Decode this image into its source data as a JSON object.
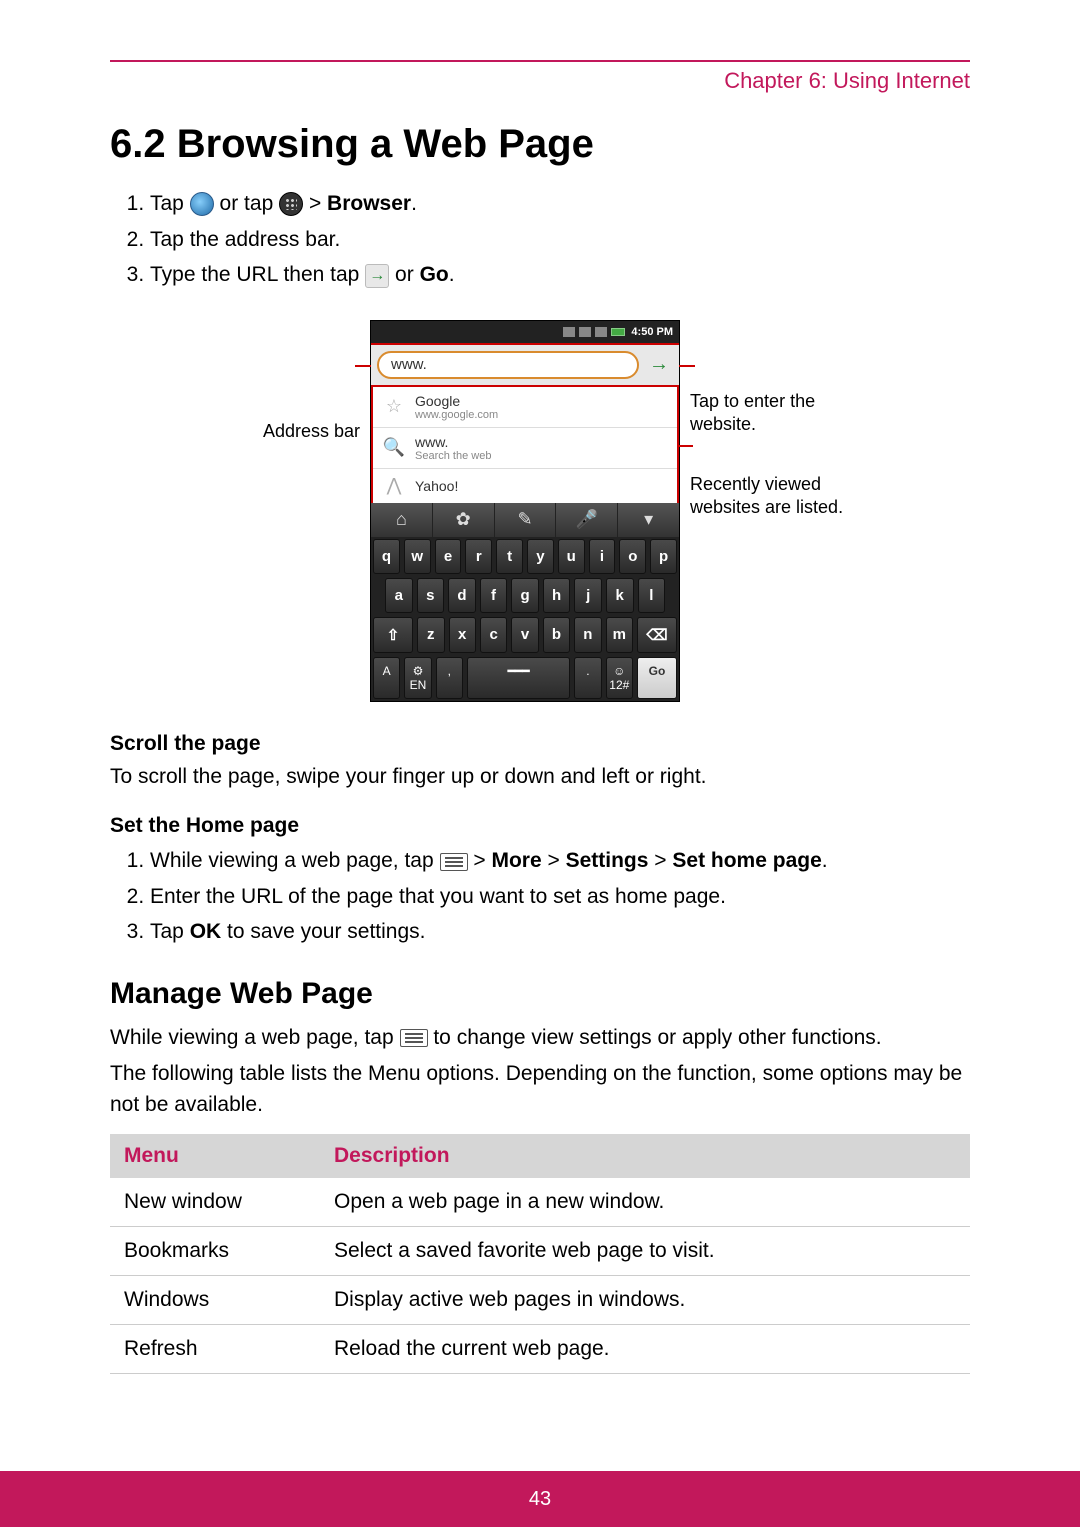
{
  "chapter": "Chapter 6: Using Internet",
  "heading": "6.2 Browsing a Web Page",
  "steps1": {
    "s1a": "Tap ",
    "s1b": " or tap ",
    "s1c": " > ",
    "s1d": "Browser",
    "s1e": ".",
    "s2": "Tap the address bar.",
    "s3a": "Type the URL then tap ",
    "s3b": " or ",
    "s3c": "Go",
    "s3d": "."
  },
  "figure": {
    "left_label": "Address bar",
    "right_label_1": "Tap to enter the website.",
    "right_label_2": "Recently viewed websites are listed.",
    "status_time": "4:50 PM",
    "addr_value": "www.",
    "suggestions": [
      {
        "icon": "star",
        "title": "Google",
        "sub": "www.google.com"
      },
      {
        "icon": "search",
        "title": "www.",
        "sub": "Search the web"
      },
      {
        "icon": "yahoo",
        "title": "Yahoo!",
        "sub": ""
      }
    ],
    "keys_row1": [
      "q",
      "w",
      "e",
      "r",
      "t",
      "y",
      "u",
      "i",
      "o",
      "p"
    ],
    "keys_row2": [
      "a",
      "s",
      "d",
      "f",
      "g",
      "h",
      "j",
      "k",
      "l"
    ],
    "keys_row3": [
      "⇧",
      "z",
      "x",
      "c",
      "v",
      "b",
      "n",
      "m",
      "⌫"
    ],
    "keys_row4_left1": "A",
    "keys_row4_left2_top": "⚙",
    "keys_row4_left2_bot": "EN",
    "keys_row4_comma": ",",
    "keys_row4_space": " ",
    "keys_row4_dot": ".",
    "keys_row4_sym_top": "☺",
    "keys_row4_sym_bot": "12#",
    "keys_row4_go": "Go"
  },
  "scroll_head": "Scroll the page",
  "scroll_body": "To scroll the page, swipe your finger up or down and left or right.",
  "home_head": "Set the Home page",
  "home_steps": {
    "s1a": "While viewing a web page, tap ",
    "s1b": " > ",
    "s1c": "More",
    "s1d": " > ",
    "s1e": "Settings",
    "s1f": " > ",
    "s1g": "Set home page",
    "s1h": ".",
    "s2": "Enter the URL of the page that you want to set as home page.",
    "s3a": "Tap ",
    "s3b": "OK",
    "s3c": " to save your settings."
  },
  "manage_head": "Manage Web Page",
  "manage_p1a": "While viewing a web page, tap ",
  "manage_p1b": " to change view settings or apply other functions.",
  "manage_p2": "The following table lists the Menu options. Depending on the function, some options may be not be available.",
  "table": {
    "head_menu": "Menu",
    "head_desc": "Description",
    "rows": [
      {
        "menu": "New window",
        "desc": "Open a web page in a new window."
      },
      {
        "menu": "Bookmarks",
        "desc": "Select a saved favorite web page to visit."
      },
      {
        "menu": "Windows",
        "desc": "Display active web pages in windows."
      },
      {
        "menu": "Refresh",
        "desc": "Reload the current web page."
      }
    ]
  },
  "page_number": "43"
}
